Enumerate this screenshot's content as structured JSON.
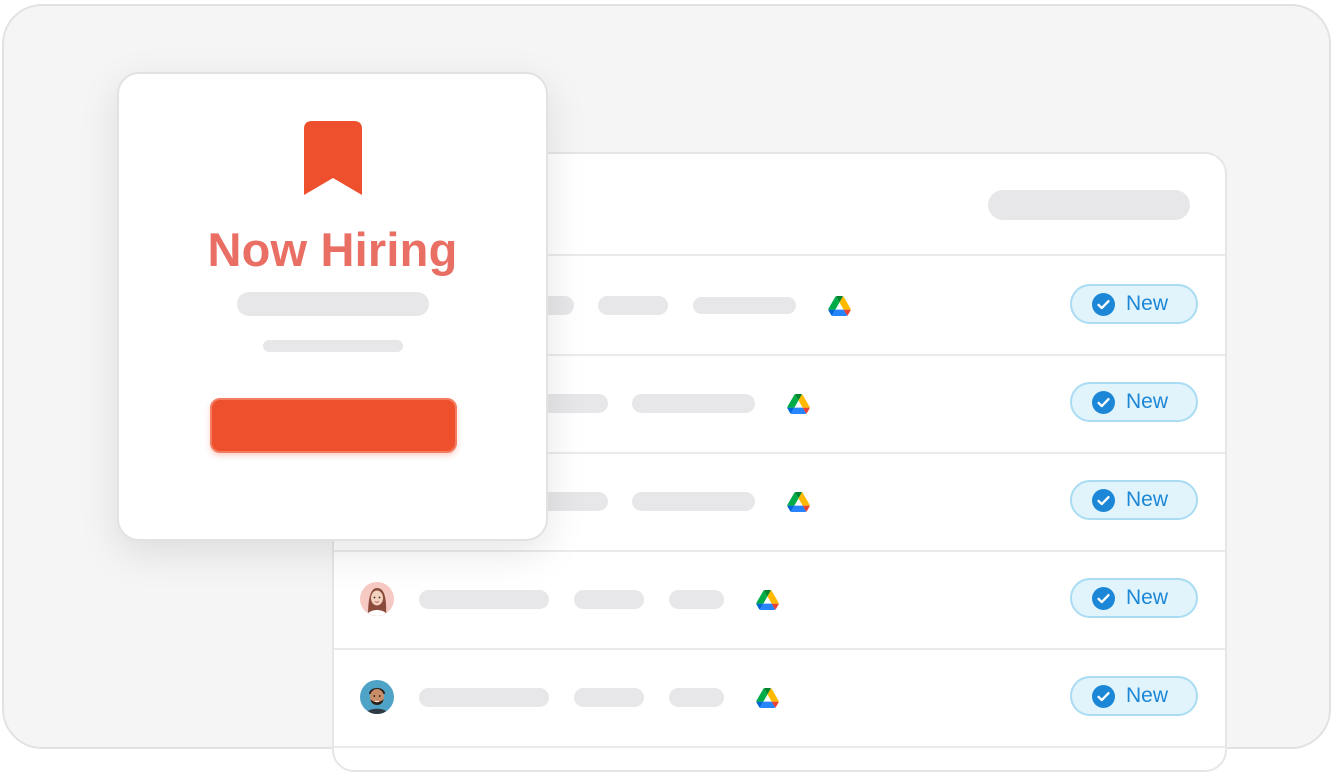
{
  "card": {
    "title": "Now Hiring",
    "bookmark_icon": "bookmark-icon",
    "accent_color": "#ee4f2c",
    "title_color": "#e96e64"
  },
  "list": {
    "rows": [
      {
        "status": "New",
        "icon": "google-drive-icon"
      },
      {
        "status": "New",
        "icon": "google-drive-icon"
      },
      {
        "status": "New",
        "icon": "google-drive-icon"
      },
      {
        "status": "New",
        "icon": "google-drive-icon",
        "avatar": "woman-avatar"
      },
      {
        "status": "New",
        "icon": "google-drive-icon",
        "avatar": "man-avatar"
      }
    ],
    "badge_color": "#1c87d6"
  }
}
